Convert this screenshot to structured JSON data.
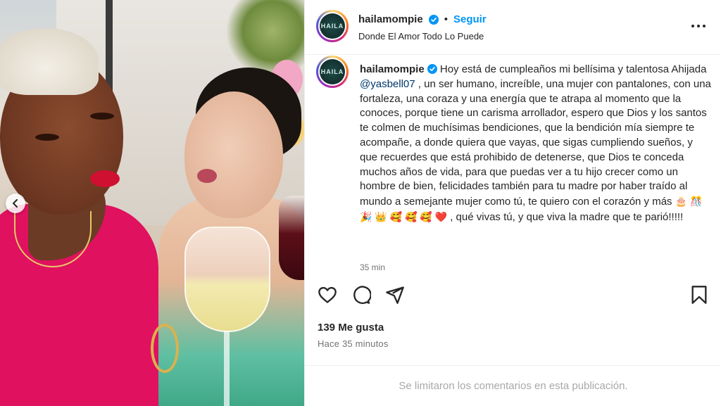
{
  "post": {
    "username": "hailamompie",
    "separator": "•",
    "follow_label": "Seguir",
    "location": "Donde El Amor Todo Lo Puede",
    "avatar_text": "HAILA",
    "caption_before_mention": "Hoy está de cumpleaños mi bellísima y talentosa Ahijada ",
    "mention": "@yasbell07",
    "caption_after_mention": " , un ser humano, increíble, una mujer con pantalones, con una fortaleza, una coraza y una energía que te atrapa al momento que la conoces, porque tiene un carisma arrollador, espero que Dios y los santos te colmen de muchísimas bendiciones, que la bendición mía siempre te acompañe, a donde quiera que vayas, que sigas cumpliendo sueños, y que recuerdes que está prohibido de detenerse, que Dios te conceda muchos años de vida, para que puedas ver a tu hijo crecer como un hombre de bien, felicidades también para tu madre por haber traído al mundo a semejante mujer como tú, te quiero con el corazón y más ",
    "caption_emojis": "🎂 🎊 🎉 👑 🥰 🥰 🥰 ❤️",
    "caption_end": " , qué vivas tú, y que viva la madre que te parió!!!!!",
    "caption_time": "35 min",
    "likes": "139 Me gusta",
    "posted_ago": "Hace 35 minutos",
    "comments_disabled": "Se limitaron los comentarios en esta publicación."
  },
  "icons": {
    "verified": "verified-badge-icon",
    "more": "more-options-icon",
    "like": "heart-icon",
    "comment": "comment-icon",
    "share": "share-icon",
    "save": "bookmark-icon",
    "carousel_prev": "chevron-left-icon"
  },
  "colors": {
    "accent": "#0095f6",
    "mention": "#00376b",
    "muted": "#737373",
    "dress": "#e0115f"
  }
}
